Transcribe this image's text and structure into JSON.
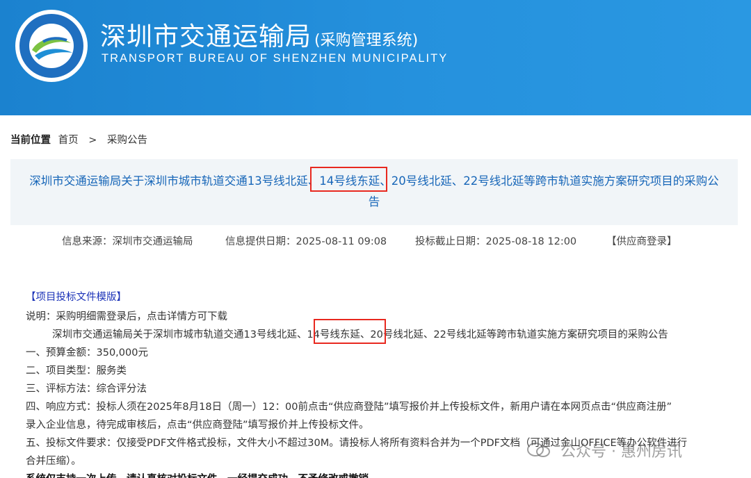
{
  "header": {
    "title": "深圳市交通运输局",
    "subtitle": "(采购管理系统)",
    "english": "TRANSPORT BUREAU OF SHENZHEN MUNICIPALITY"
  },
  "breadcrumb": {
    "label": "当前位置",
    "home": "首页",
    "separator": ">",
    "current": "采购公告"
  },
  "notice": {
    "title_line1": "深圳市交通运输局关于深圳市城市轨道交通13号线北延、14号线东延、20号线北延、22号线北延等跨市轨道实施方案研究项目的采购公",
    "title_line2": "告"
  },
  "meta": {
    "source": "信息来源：深圳市交通运输局",
    "date": "信息提供日期：2025-08-11 09:08",
    "deadline": "投标截止日期：2025-08-18 12:00",
    "login": "【供应商登录】"
  },
  "content": {
    "template_link": "【项目投标文件模版】",
    "note": "说明：采购明细需登录后，点击详情方可下载",
    "project_name": "深圳市交通运输局关于深圳市城市轨道交通13号线北延、14号线东延、20号线北延、22号线北延等跨市轨道实施方案研究项目的采购公告",
    "item1": "一、预算金额：350,000元",
    "item2": "二、项目类型：服务类",
    "item3": "三、评标方法：综合评分法",
    "item4a": "四、响应方式：投标人须在2025年8月18日（周一）12：00前点击“供应商登陆”填写报价并上传投标文件，新用户请在本网页点击“供应商注册”",
    "item4b": "录入企业信息，待完成审核后，点击“供应商登陆”填写报价并上传投标文件。",
    "item5a": "五、投标文件要求：仅接受PDF文件格式投标，文件大小不超过30M。请投标人将所有资料合并为一个PDF文档（可通过金山OFFICE等办公软件进行",
    "item5b": "合并压缩）。",
    "item6": "系统仅支持一次上传，请认真核对投标文件，一经提交成功，不予修改或撤销。"
  },
  "watermark": "公众号 · 惠州房讯",
  "colors": {
    "header_bg": "#2591dd",
    "title_blue": "#1766b8",
    "highlight_red": "#e8281f",
    "link_blue": "#1c33b8"
  }
}
